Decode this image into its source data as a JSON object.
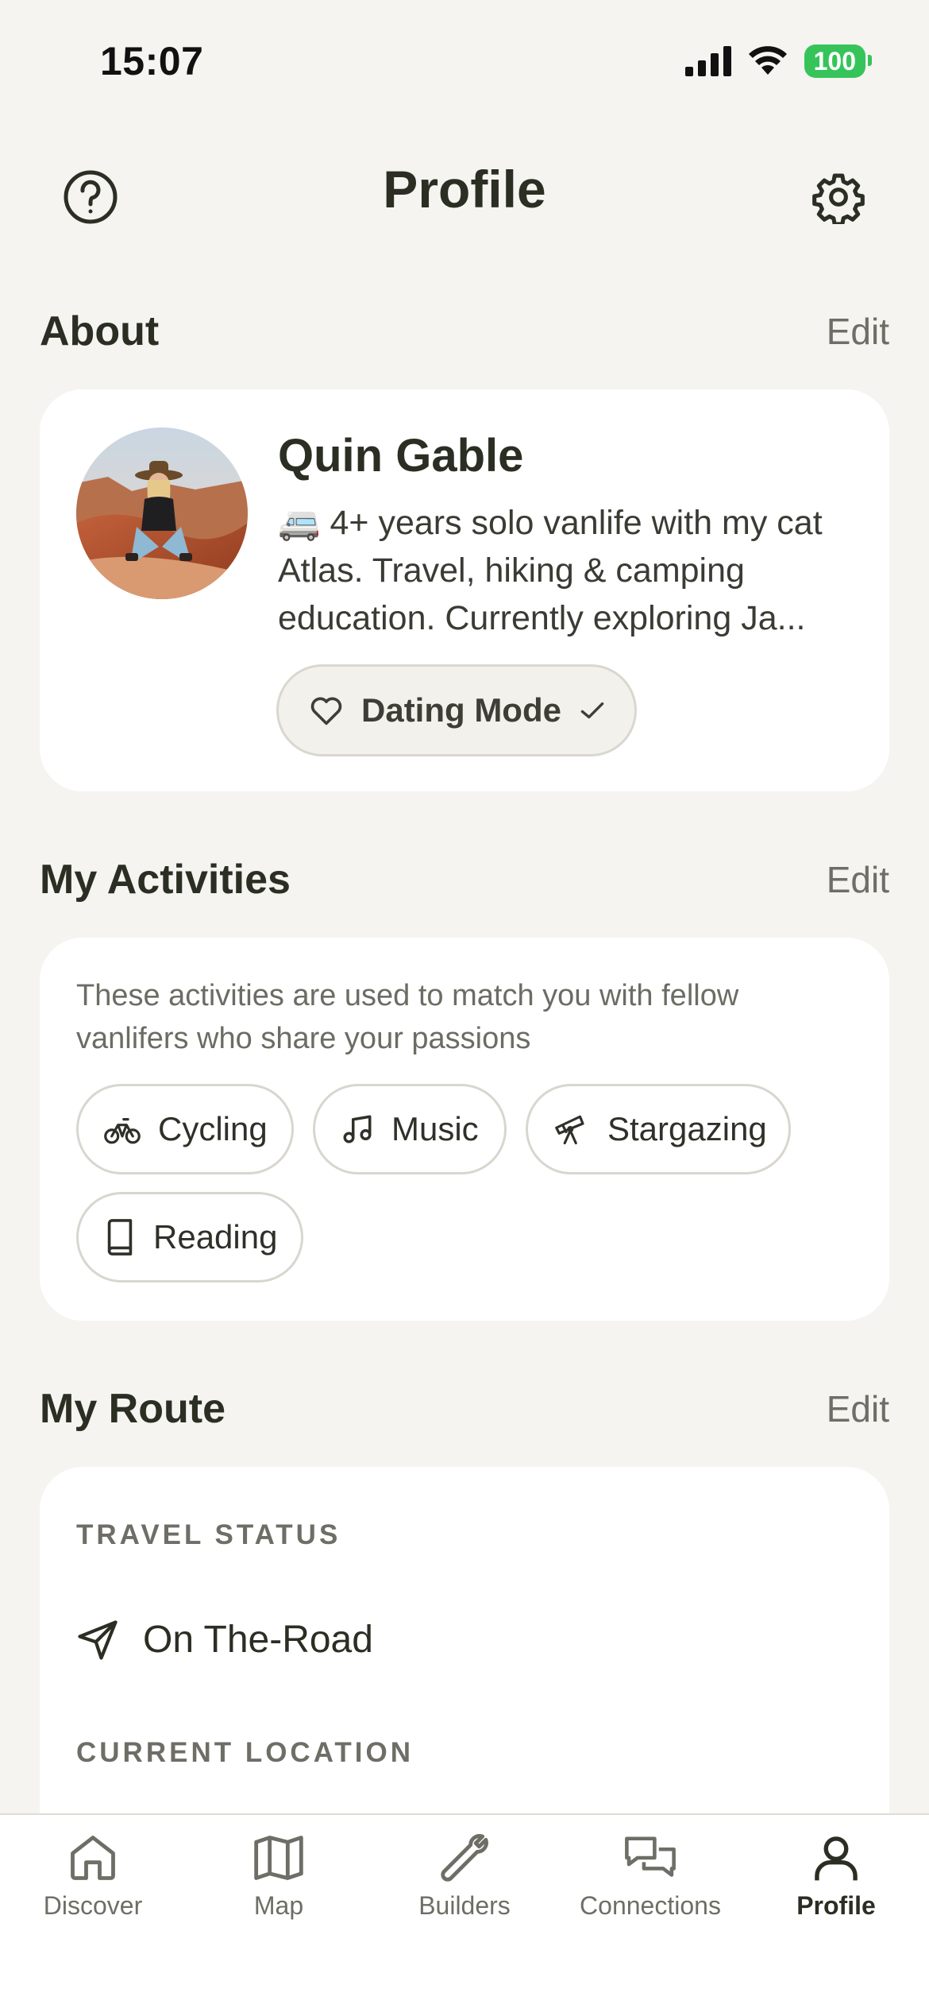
{
  "status_bar": {
    "time": "15:07",
    "battery": "100"
  },
  "header": {
    "title": "Profile"
  },
  "about": {
    "title": "About",
    "edit_label": "Edit",
    "name": "Quin Gable",
    "bio": "🚐 4+ years solo vanlife with my cat Atlas. Travel, hiking & camping education. Currently exploring Ja...",
    "dating_mode_label": "Dating Mode"
  },
  "activities": {
    "title": "My Activities",
    "edit_label": "Edit",
    "description": "These activities are used to match you with fellow vanlifers who share your passions",
    "items": [
      {
        "label": "Cycling",
        "icon": "bicycle-icon"
      },
      {
        "label": "Music",
        "icon": "music-note-icon"
      },
      {
        "label": "Stargazing",
        "icon": "telescope-icon"
      },
      {
        "label": "Reading",
        "icon": "book-icon"
      }
    ]
  },
  "route": {
    "title": "My Route",
    "edit_label": "Edit",
    "travel_status_label": "TRAVEL STATUS",
    "travel_status_value": "On The-Road",
    "current_location_label": "CURRENT LOCATION"
  },
  "tabs": [
    {
      "label": "Discover",
      "icon": "home-icon"
    },
    {
      "label": "Map",
      "icon": "map-icon"
    },
    {
      "label": "Builders",
      "icon": "wrench-icon"
    },
    {
      "label": "Connections",
      "icon": "chat-icon"
    },
    {
      "label": "Profile",
      "icon": "user-icon",
      "active": true
    }
  ],
  "colors": {
    "background": "#f5f4f0",
    "card": "#ffffff",
    "text": "#2b2e22",
    "battery": "#36c45a"
  }
}
